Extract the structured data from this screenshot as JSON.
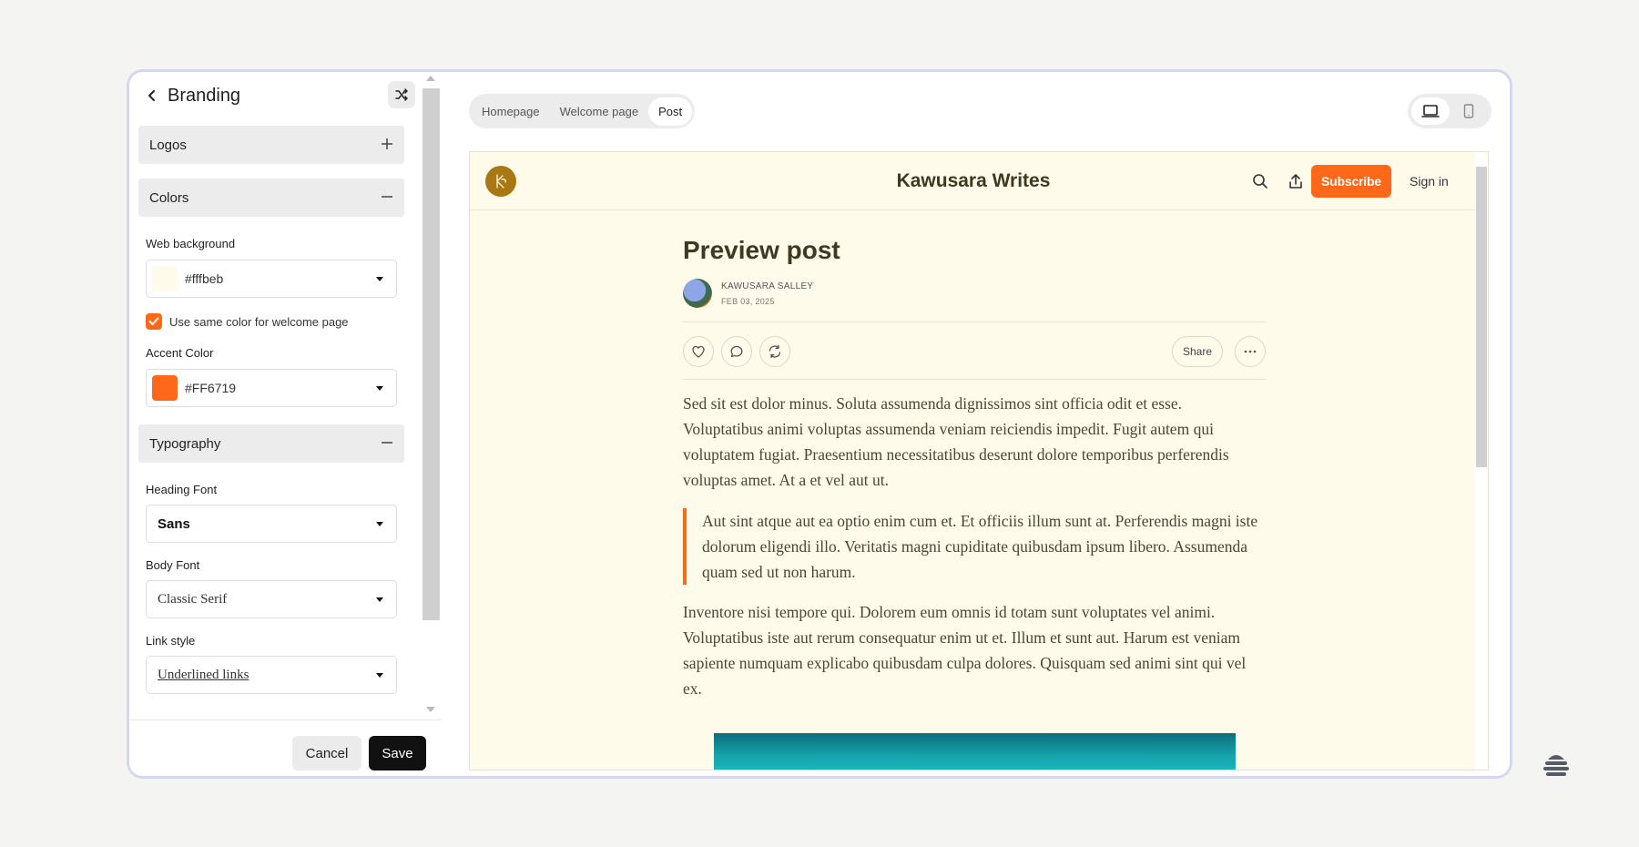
{
  "panel": {
    "title": "Branding",
    "sections": {
      "logos": "Logos",
      "colors": "Colors",
      "typography": "Typography"
    },
    "colors": {
      "web_background_label": "Web background",
      "web_background_value": "#fffbeb",
      "same_color_label": "Use same color for welcome page",
      "same_color_checked": true,
      "accent_label": "Accent Color",
      "accent_value": "#FF6719"
    },
    "typography": {
      "heading_font_label": "Heading Font",
      "heading_font_value": "Sans",
      "body_font_label": "Body Font",
      "body_font_value": "Classic Serif",
      "link_style_label": "Link style",
      "link_style_value": "Underlined links"
    },
    "footer": {
      "cancel": "Cancel",
      "save": "Save"
    }
  },
  "preview": {
    "tabs": [
      "Homepage",
      "Welcome page",
      "Post"
    ],
    "active_tab": "Post",
    "device": "desktop",
    "site": {
      "title": "Kawusara Writes",
      "subscribe": "Subscribe",
      "signin": "Sign in"
    },
    "post": {
      "title": "Preview post",
      "author": "KAWUSARA SALLEY",
      "date": "FEB 03, 2025",
      "share": "Share",
      "para1": "Sed sit est dolor minus. Soluta assumenda dignissimos sint officia odit et esse. Voluptatibus animi voluptas assumenda veniam reiciendis impedit. Fugit autem qui voluptatem fugiat. Praesentium necessitatibus deserunt dolore temporibus perferendis voluptas amet. At a et vel aut ut.",
      "quote": "Aut sint atque aut ea optio enim cum et. Et officiis illum sunt at. Perferendis magni iste dolorum eligendi illo. Veritatis magni cupiditate quibusdam ipsum libero. Assumenda quam sed ut non harum.",
      "para2": "Inventore nisi tempore qui. Dolorem eum omnis id totam sunt voluptates vel animi. Voluptatibus iste aut rerum consequatur enim ut et. Illum et sunt aut. Harum est veniam sapiente numquam explicabo quibusdam culpa dolores. Quisquam sed animi sint qui vel ex."
    }
  },
  "colors": {
    "accent": "#FF6719",
    "web_background": "#fffbeb",
    "logo": "#a97812"
  },
  "icons": [
    "chevron-left-icon",
    "shuffle-icon",
    "plus-icon",
    "minus-icon",
    "check-icon",
    "laptop-icon",
    "phone-icon",
    "search-icon",
    "share-upload-icon",
    "heart-icon",
    "comment-icon",
    "restack-icon",
    "more-icon",
    "brand-logo-icon"
  ]
}
